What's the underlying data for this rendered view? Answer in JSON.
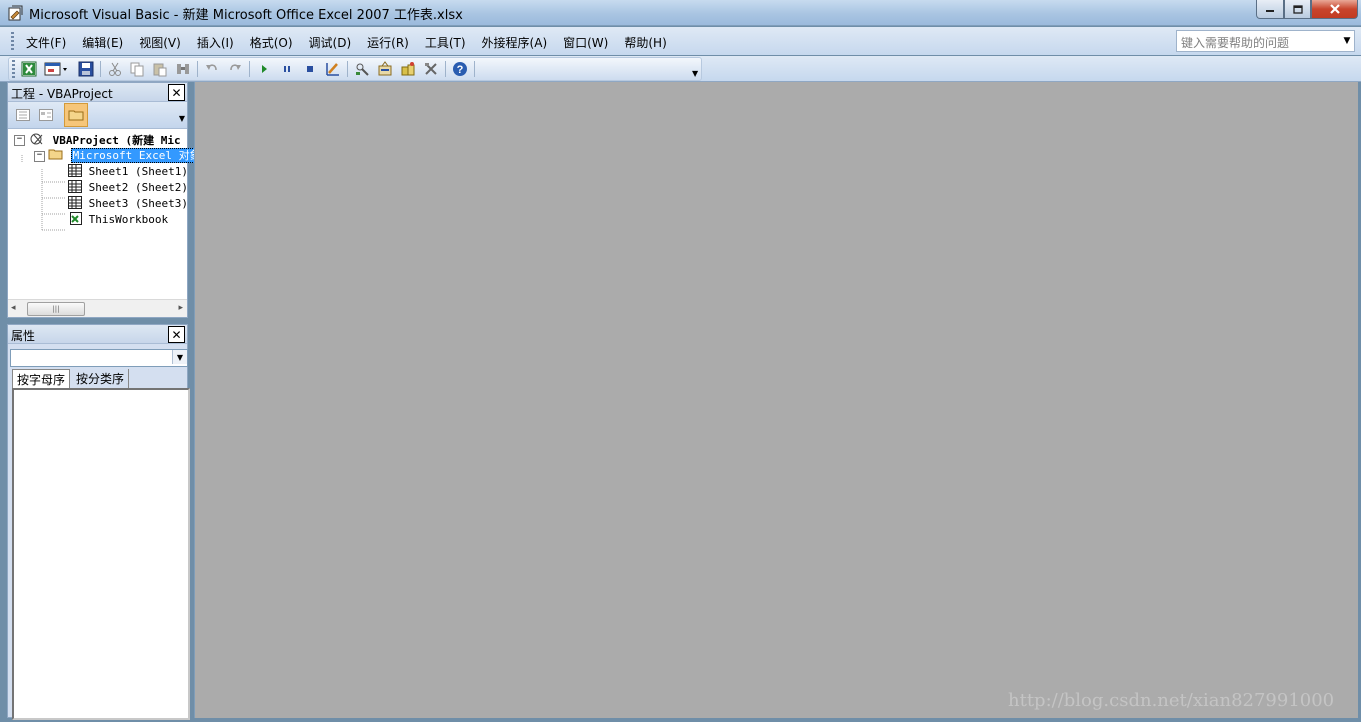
{
  "window": {
    "title": "Microsoft Visual Basic - 新建 Microsoft Office Excel 2007 工作表.xlsx",
    "accent": "#c23b22"
  },
  "menu": {
    "items": [
      "文件(F)",
      "编辑(E)",
      "视图(V)",
      "插入(I)",
      "格式(O)",
      "调试(D)",
      "运行(R)",
      "工具(T)",
      "外接程序(A)",
      "窗口(W)",
      "帮助(H)"
    ],
    "help_placeholder": "键入需要帮助的问题"
  },
  "toolbar": {
    "icons": [
      "excel-icon",
      "insert-userform-icon",
      "save-icon",
      "cut-icon",
      "copy-icon",
      "paste-icon",
      "find-icon",
      "undo-icon",
      "redo-icon",
      "run-icon",
      "break-icon",
      "reset-icon",
      "design-mode-icon",
      "project-explorer-icon",
      "properties-icon",
      "object-browser-icon",
      "toolbox-icon",
      "help-icon"
    ]
  },
  "project_pane": {
    "title": "工程 - VBAProject",
    "tree": {
      "root": "VBAProject (新建 Mic",
      "folder": "Microsoft Excel 对象",
      "items": [
        "Sheet1 (Sheet1)",
        "Sheet2 (Sheet2)",
        "Sheet3 (Sheet3)",
        "ThisWorkbook"
      ]
    }
  },
  "properties_pane": {
    "title": "属性",
    "tabs": [
      "按字母序",
      "按分类序"
    ]
  },
  "watermark": "http://blog.csdn.net/xian827991000"
}
